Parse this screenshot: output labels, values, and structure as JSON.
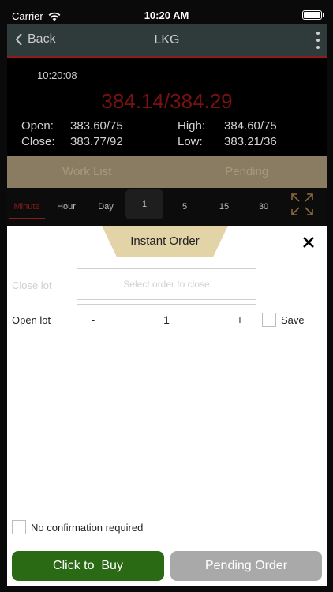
{
  "status_bar": {
    "carrier": "Carrier",
    "time": "10:20 AM"
  },
  "nav": {
    "back_label": "Back",
    "title": "LKG"
  },
  "quote": {
    "time": "10:20:08",
    "price": "384.14/384.29",
    "open_label": "Open:",
    "open_value": "383.60/75",
    "close_label": "Close:",
    "close_value": "383.77/92",
    "high_label": "High:",
    "high_value": "384.60/75",
    "low_label": "Low:",
    "low_value": "383.21/36"
  },
  "tabs": {
    "work_list": "Work List",
    "pending": "Pending"
  },
  "periods": {
    "minute": "Minute",
    "hour": "Hour",
    "day": "Day",
    "p1": "1",
    "p5": "5",
    "p15": "15",
    "p30": "30"
  },
  "order": {
    "title": "Instant Order",
    "close_lot_label": "Close lot",
    "close_lot_placeholder": "Select order to close",
    "open_lot_label": "Open lot",
    "minus": "-",
    "plus": "+",
    "open_lot_value": "1",
    "save_label": "Save",
    "no_confirm_label": "No confirmation required",
    "buy_label": "Click to  Buy",
    "pending_label": "Pending Order"
  },
  "colors": {
    "accent_red": "#8a1c1c",
    "buy_green": "#2a6a14",
    "tab_gold": "#8a7c62",
    "sheet_header": "#e3d4a8"
  }
}
